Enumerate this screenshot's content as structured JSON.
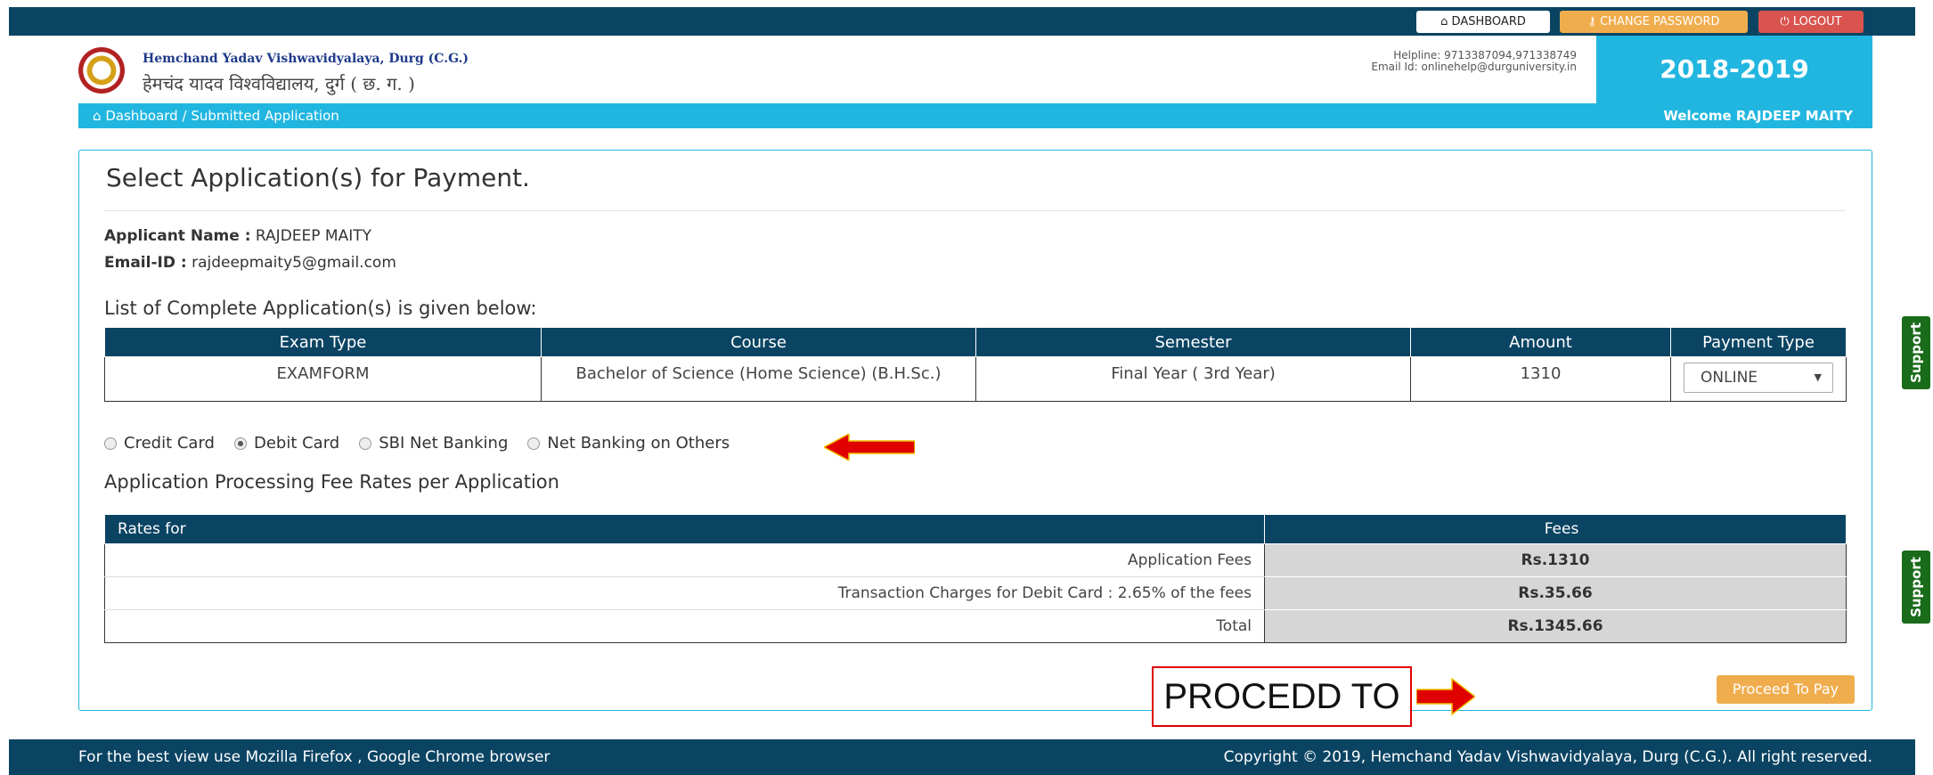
{
  "topbar": {
    "dashboard_label": "DASHBOARD",
    "change_password_label": "CHANGE PASSWORD",
    "logout_label": "LOGOUT"
  },
  "header": {
    "university_en": "Hemchand Yadav Vishwavidyalaya, Durg (C.G.)",
    "university_hi": "हेमचंद यादव विश्वविद्यालय, दुर्ग ( छ. ग. )",
    "helpline": "Helpline: 9713387094,971338749",
    "email_id": "Email Id: onlinehelp@durguniversity.in",
    "session": "2018-2019"
  },
  "breadcrumb": {
    "home": "Dashboard",
    "separator": "/",
    "current": "Submitted Application",
    "welcome": "Welcome RAJDEEP MAITY"
  },
  "panel": {
    "title": "Select Application(s) for Payment.",
    "applicant_label": "Applicant Name :",
    "applicant_name": "RAJDEEP MAITY",
    "email_label": "Email-ID :",
    "email": "rajdeepmaity5@gmail.com",
    "list_caption": "List of Complete Application(s) is given below:"
  },
  "applications": {
    "headers": [
      "Exam Type",
      "Course",
      "Semester",
      "Amount",
      "Payment Type"
    ],
    "rows": [
      {
        "exam_type": "EXAMFORM",
        "course": "Bachelor of Science (Home Science) (B.H.Sc.)",
        "semester": "Final Year ( 3rd Year)",
        "amount": "1310",
        "payment_type": "ONLINE"
      }
    ]
  },
  "payment_methods": {
    "options": [
      "Credit Card",
      "Debit Card",
      "SBI Net Banking",
      "Net Banking on Others"
    ],
    "selected": "Debit Card"
  },
  "fees": {
    "caption": "Application Processing Fee Rates per Application",
    "header_rates": "Rates for",
    "header_fees": "Fees",
    "rows": [
      {
        "label": "Application Fees",
        "value": "Rs.1310"
      },
      {
        "label": "Transaction Charges for Debit Card : 2.65% of the fees",
        "value": "Rs.35.66"
      },
      {
        "label": "Total",
        "value": "Rs.1345.66"
      }
    ]
  },
  "annotation": {
    "text": "PROCEDD TO PAY",
    "arrow_color": "#e00000"
  },
  "actions": {
    "proceed_label": "Proceed To Pay"
  },
  "support": {
    "label": "Support"
  },
  "footer": {
    "left": "For the best view use Mozilla Firefox , Google Chrome browser",
    "right": "Copyright © 2019, Hemchand Yadav Vishwavidyalaya, Durg (C.G.). All right reserved."
  },
  "colors": {
    "navy": "#0b4463",
    "cyan": "#21b6e0",
    "orange": "#f0ad4e",
    "red": "#d9534f",
    "support_green": "#1a6b1a"
  }
}
